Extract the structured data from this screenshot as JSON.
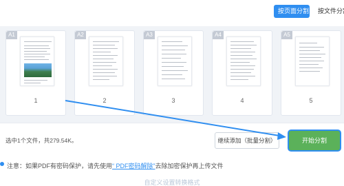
{
  "toolbar": {
    "active_mode": "按页面分割",
    "inactive_mode": "按文件分割"
  },
  "pages": [
    {
      "badge": "A1",
      "number": "1"
    },
    {
      "badge": "A2",
      "number": "2"
    },
    {
      "badge": "A3",
      "number": "3"
    },
    {
      "badge": "A4",
      "number": "4"
    },
    {
      "badge": "A5",
      "number": "5"
    }
  ],
  "status": {
    "selection_text": "选中1个文件，共279.54K。",
    "add_batch_label": "继续添加（批量分割）",
    "start_label": "开始分割"
  },
  "note": {
    "prefix": "注意：如果PDF有密码保护，请先使用",
    "link": "“ PDF密码解除”",
    "suffix": "去除加密保护再上传文件"
  },
  "footer": {
    "partial_text": "自定义设置转换格式"
  },
  "colors": {
    "accent_blue": "#2f8ef0",
    "start_green": "#5bb15a",
    "pages_bg": "#f0f3f7"
  }
}
